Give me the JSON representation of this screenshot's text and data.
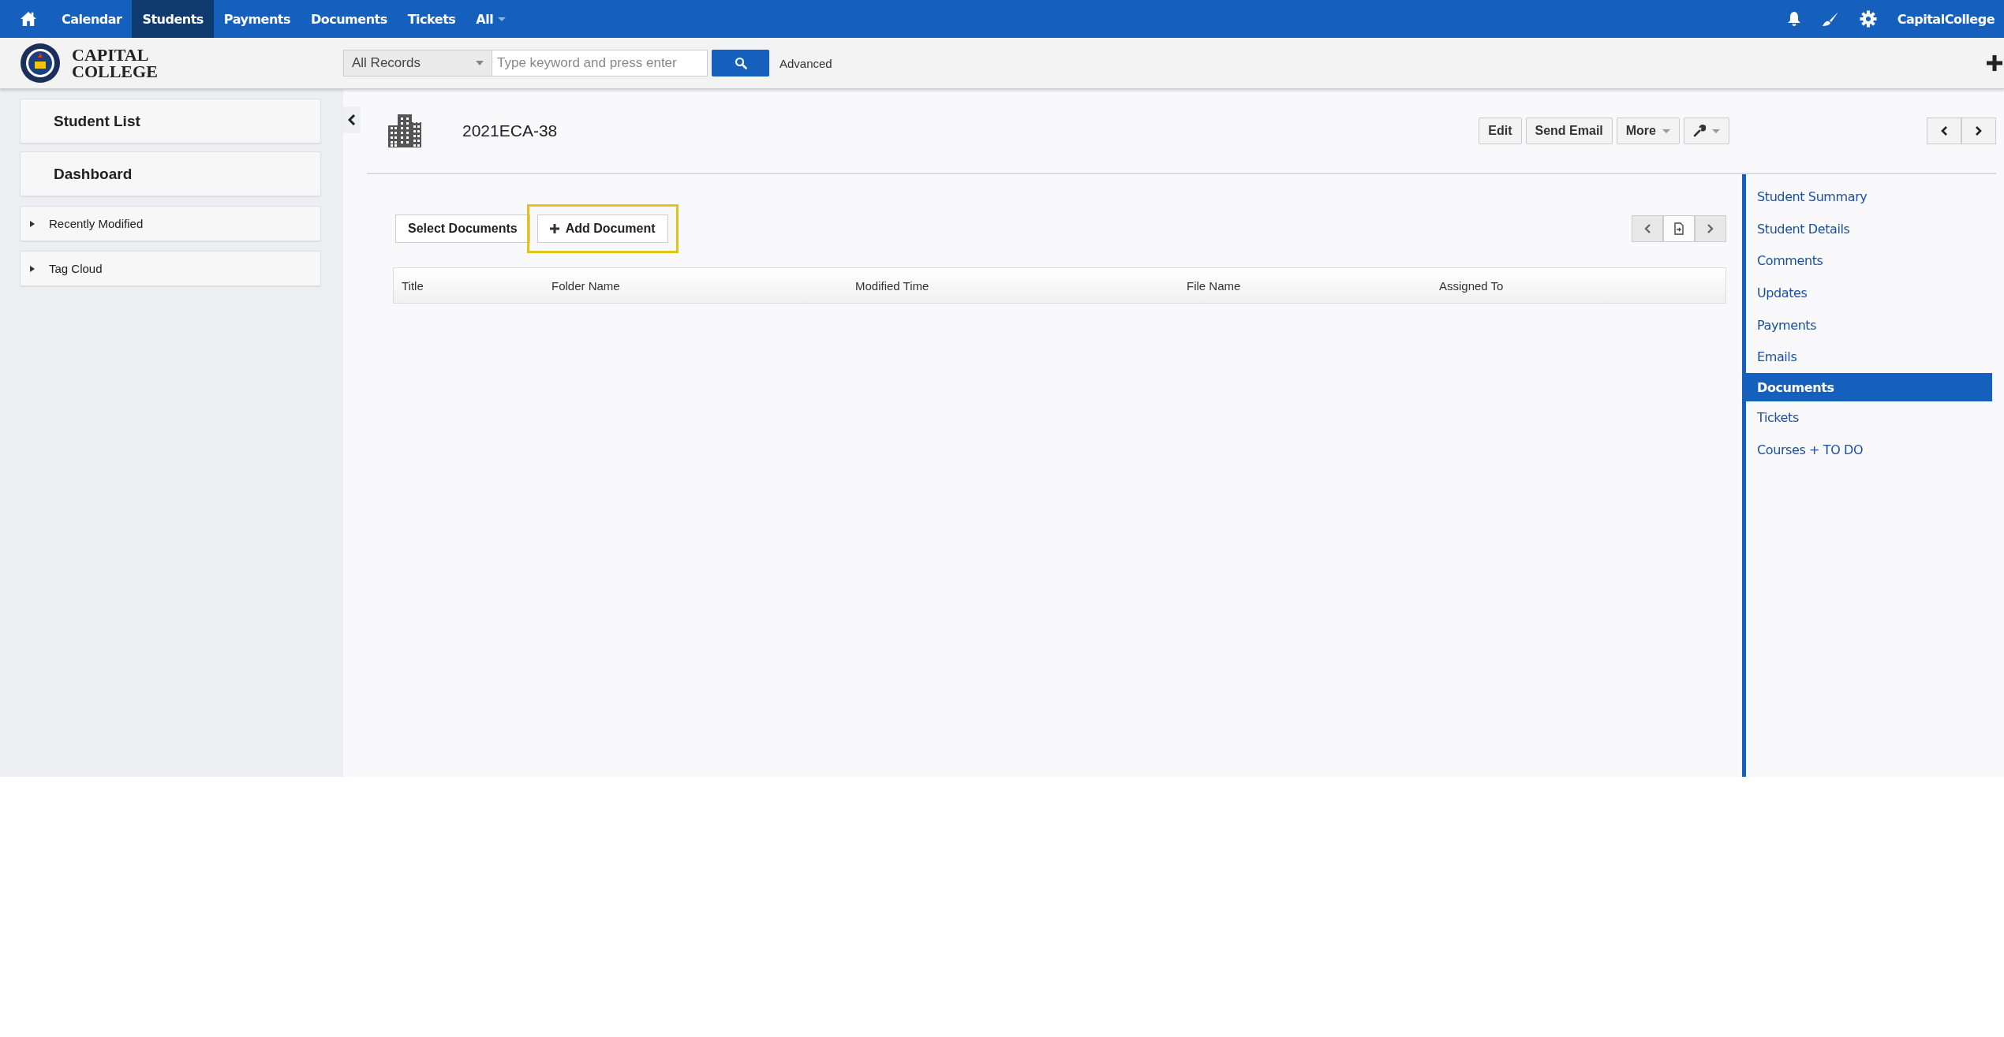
{
  "top_nav": {
    "items": [
      {
        "label": "Calendar",
        "selected": false
      },
      {
        "label": "Students",
        "selected": true
      },
      {
        "label": "Payments",
        "selected": false
      },
      {
        "label": "Documents",
        "selected": false
      },
      {
        "label": "Tickets",
        "selected": false
      },
      {
        "label": "All",
        "selected": false
      }
    ],
    "user": "CapitalCollege"
  },
  "header": {
    "logo_lines": [
      "CAPITAL",
      "COLLEGE"
    ],
    "search": {
      "scope": "All Records",
      "placeholder": "Type keyword and press enter",
      "advanced": "Advanced"
    }
  },
  "sidebar": {
    "items": [
      {
        "kind": "link",
        "label": "Student List"
      },
      {
        "kind": "link",
        "label": "Dashboard"
      },
      {
        "kind": "section",
        "label": "Recently Modified",
        "expanded": false
      },
      {
        "kind": "section",
        "label": "Tag Cloud",
        "expanded": false
      }
    ]
  },
  "record": {
    "title": "2021ECA-38",
    "actions": [
      "Edit",
      "Send Email",
      "More"
    ]
  },
  "documents": {
    "buttons": [
      {
        "label": "Select Documents",
        "highlighted": false
      },
      {
        "label": "Add Document",
        "highlighted": true
      }
    ],
    "table": {
      "columns": [
        "Title",
        "Folder Name",
        "Modified Time",
        "File Name",
        "Assigned To"
      ]
    }
  },
  "related_nav": {
    "items": [
      {
        "label": "Student Summary",
        "selected": false
      },
      {
        "label": "Student Details",
        "selected": false
      },
      {
        "label": "Comments",
        "selected": false
      },
      {
        "label": "Updates",
        "selected": false
      },
      {
        "label": "Payments",
        "selected": false
      },
      {
        "label": "Emails",
        "selected": false
      },
      {
        "label": "Documents",
        "selected": true
      },
      {
        "label": "Tickets",
        "selected": false
      },
      {
        "label": "Courses + TO DO",
        "selected": false
      }
    ]
  }
}
